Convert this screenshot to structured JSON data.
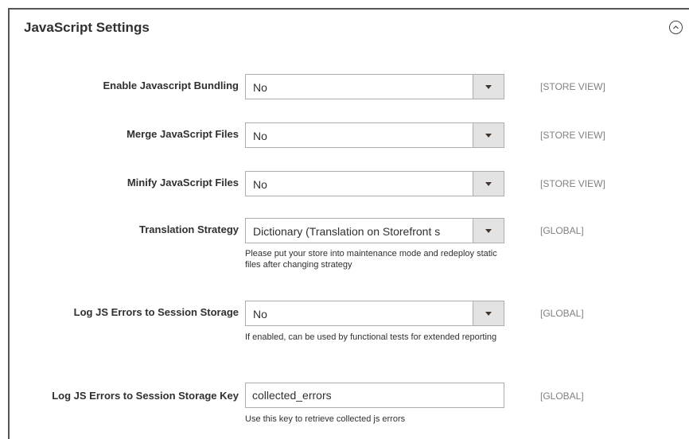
{
  "section": {
    "title": "JavaScript Settings",
    "collapse_icon": "chevron-up-circle-icon"
  },
  "fields": [
    {
      "label": "Enable Javascript Bundling",
      "value": "No",
      "scope": "[STORE VIEW]"
    },
    {
      "label": "Merge JavaScript Files",
      "value": "No",
      "scope": "[STORE VIEW]"
    },
    {
      "label": "Minify JavaScript Files",
      "value": "No",
      "scope": "[STORE VIEW]"
    },
    {
      "label": "Translation Strategy",
      "value": "Dictionary (Translation on Storefront s",
      "scope": "[GLOBAL]",
      "note": "Please put your store into maintenance mode and redeploy static files after changing strategy"
    },
    {
      "label": "Log JS Errors to Session Storage",
      "value": "No",
      "scope": "[GLOBAL]",
      "note": "If enabled, can be used by functional tests for extended reporting"
    },
    {
      "label": "Log JS Errors to Session Storage Key",
      "value": "collected_errors",
      "scope": "[GLOBAL]",
      "note": "Use this key to retrieve collected js errors"
    }
  ],
  "colors": {
    "label": "#303030",
    "scope": "#808080",
    "select_button": "#e3e3e3",
    "border": "#adadad"
  }
}
